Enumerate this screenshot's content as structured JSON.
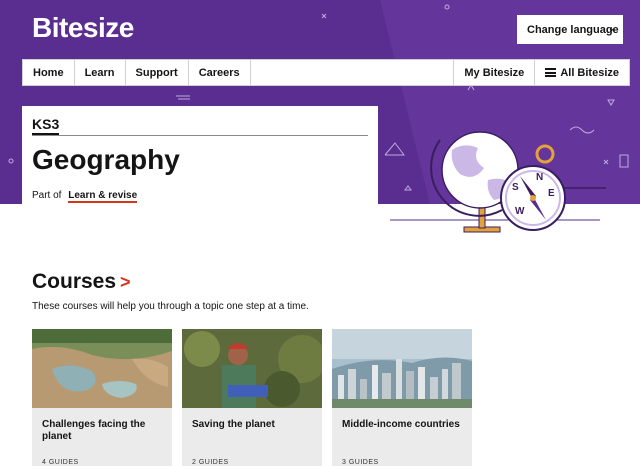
{
  "header": {
    "logo": "Bitesize",
    "language_button": "Change language",
    "language_chevron": "⌄"
  },
  "nav": {
    "items": [
      "Home",
      "Learn",
      "Support",
      "Careers"
    ],
    "my_bitesize": "My Bitesize",
    "all_bitesize": "All Bitesize"
  },
  "hero": {
    "stage": "KS3",
    "title": "Geography",
    "part_of_prefix": "Part of",
    "part_of_link": "Learn & revise"
  },
  "courses": {
    "heading": "Courses",
    "arrow": ">",
    "description": "These courses will help you through a topic one step at a time.",
    "cards": [
      {
        "title": "Challenges facing the planet",
        "meta": "4 GUIDES"
      },
      {
        "title": "Saving the planet",
        "meta": "2 GUIDES"
      },
      {
        "title": "Middle-income countries",
        "meta": "3 GUIDES"
      }
    ]
  },
  "colors": {
    "brand_purple": "#5a2d91",
    "accent_red": "#d4351c",
    "card_bg": "#ebebeb"
  }
}
